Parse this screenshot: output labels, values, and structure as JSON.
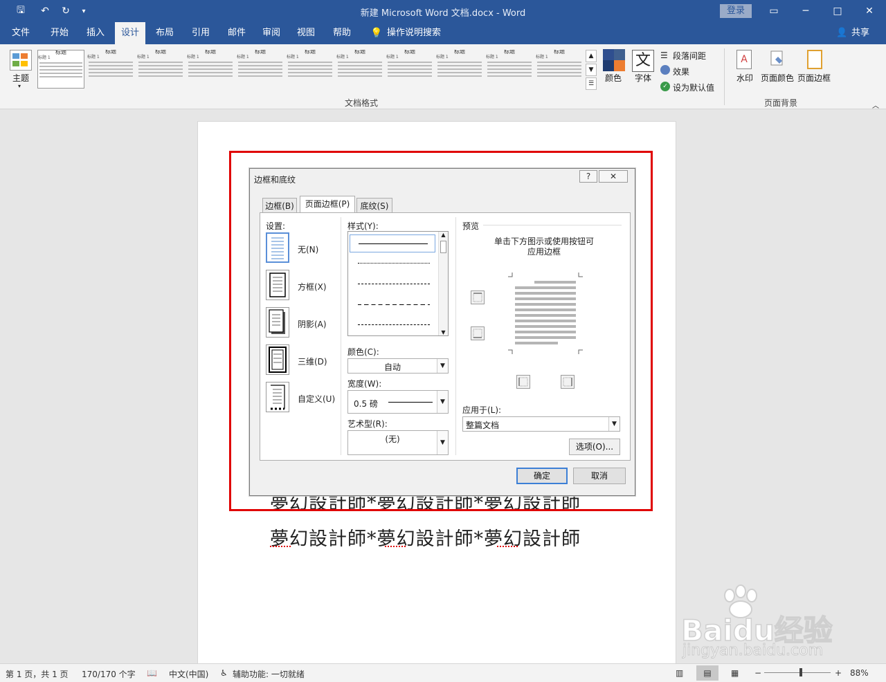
{
  "window": {
    "title": "新建 Microsoft Word 文档.docx  -  Word",
    "login": "登录",
    "min": "─",
    "restore": "□",
    "close": "✕"
  },
  "qat": {
    "save": "🖫",
    "undo": "↶",
    "redo": "↻",
    "customize": "▾"
  },
  "tabs": [
    "文件",
    "开始",
    "插入",
    "设计",
    "布局",
    "引用",
    "邮件",
    "审阅",
    "视图",
    "帮助"
  ],
  "active_tab": "设计",
  "tellme": "操作说明搜索",
  "share": "共享",
  "ribbon": {
    "theme": "主题",
    "style_tiles": [
      {
        "title": "标题",
        "sub": "标题 1"
      },
      {
        "title": "标题",
        "sub": "标题 1"
      },
      {
        "title": "标题",
        "sub": "标题 1"
      },
      {
        "title": "标题",
        "sub": "标题 1"
      },
      {
        "title": "标题",
        "sub": "标题 1"
      },
      {
        "title": "标题",
        "sub": "标题 1"
      },
      {
        "title": "标题",
        "sub": "标题 1"
      },
      {
        "title": "标题",
        "sub": "标题 1"
      },
      {
        "title": "标题",
        "sub": "标题 1"
      },
      {
        "title": "标题",
        "sub": "标题 1"
      },
      {
        "title": "标题",
        "sub": "标题 1"
      }
    ],
    "doc_format_label": "文档格式",
    "colors": "颜色",
    "fonts": "字体",
    "fonts_glyph": "文",
    "paragraph_spacing": "段落间距",
    "effects": "效果",
    "set_default": "设为默认值",
    "watermark": "水印",
    "page_color": "页面颜色",
    "page_borders": "页面边框",
    "page_background_label": "页面背景"
  },
  "document": {
    "lines": [
      "夢幻設計師*夢幻設計師*夢幻設計師",
      "夢幻設計師*夢幻設計師*夢幻設計師"
    ]
  },
  "dialog": {
    "title": "边框和底纹",
    "help": "?",
    "close": "✕",
    "tabs": [
      "边框(B)",
      "页面边框(P)",
      "底纹(S)"
    ],
    "active_tab": "页面边框(P)",
    "setting_label": "设置:",
    "settings": [
      "无(N)",
      "方框(X)",
      "阴影(A)",
      "三维(D)",
      "自定义(U)"
    ],
    "style_label": "样式(Y):",
    "color_label": "颜色(C):",
    "color_value": "自动",
    "width_label": "宽度(W):",
    "width_value": "0.5 磅",
    "art_label": "艺术型(R):",
    "art_value": "(无)",
    "preview_label": "预览",
    "preview_hint": "单击下方图示或使用按钮可\n应用边框",
    "apply_label": "应用于(L):",
    "apply_value": "整篇文档",
    "options": "选项(O)...",
    "ok": "确定",
    "cancel": "取消"
  },
  "status": {
    "page": "第 1 页，共 1 页",
    "words": "170/170 个字",
    "lang": "中文(中国)",
    "accessibility": "辅助功能: 一切就绪",
    "zoom": "88%",
    "zoom_level": 0.88
  },
  "watermark": {
    "brand": "Baidu经验",
    "url": "jingyan.baidu.com"
  },
  "colors": {
    "titlebar": "#2b579a",
    "highlight": "#e00000"
  }
}
